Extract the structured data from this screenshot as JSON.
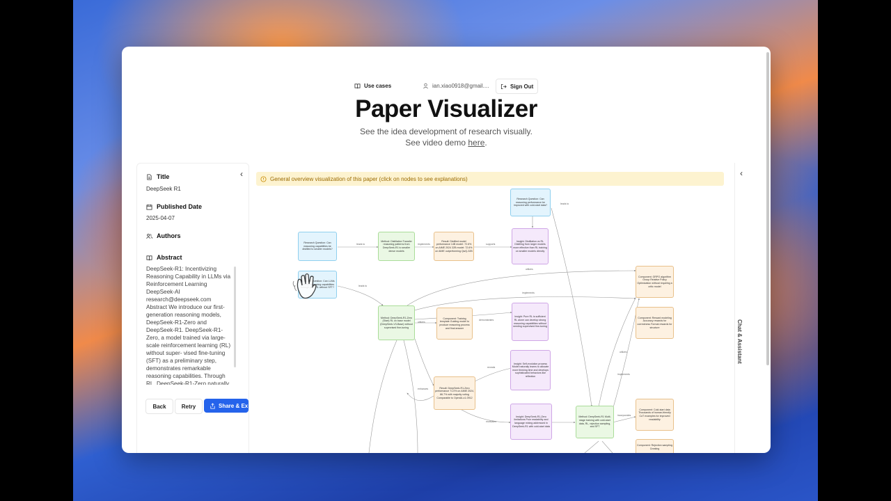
{
  "nav": {
    "use_cases": "Use cases",
    "email": "ian.xiao0918@gmail....",
    "sign_out": "Sign Out"
  },
  "header": {
    "title": "Paper Visualizer",
    "subtitle": "See the idea development of research visually.",
    "demo_prefix": "See video demo ",
    "demo_link": "here",
    "demo_suffix": "."
  },
  "paper": {
    "title_label": "Title",
    "title_value": "DeepSeek R1",
    "date_label": "Published Date",
    "date_value": "2025-04-07",
    "authors_label": "Authors",
    "abstract_label": "Abstract",
    "abstract_text": "DeepSeek-R1: Incentivizing Reasoning Capability in LLMs via Reinforcement Learning DeepSeek-AI research@deepseek.com Abstract We introduce our first-generation reasoning models, DeepSeek-R1-Zero and DeepSeek-R1. DeepSeek-R1-Zero, a model trained via large-scale reinforcement learning (RL) without super- vised fine-tuning (SFT) as a preliminary step, demonstrates remarkable reasoning capabilities. Through RL, DeepSeek-R1-Zero naturally"
  },
  "actions": {
    "back": "Back",
    "retry": "Retry",
    "share": "Share & Ex"
  },
  "banner": "General overview visualization of this paper (click on nodes to see explanations)",
  "sidebar_right": {
    "label": "Chat & Assistant"
  },
  "colors": {
    "accent": "#2563eb",
    "banner_bg": "#fdf3d0"
  },
  "graph": {
    "nodes": [
      {
        "id": "rq1",
        "color": "blue",
        "text": "Research Question: Can reasoning capabilities be distilled to smaller models?"
      },
      {
        "id": "m1",
        "color": "green",
        "text": "Method: Distillation Transfer reasoning patterns from DeepSeek-R1 to smaller dense models"
      },
      {
        "id": "r1",
        "color": "orange",
        "text": "Result: Distilled model performance 14B model: 72.6% on AIME 2024 32B model: 72.6% on AIME outperforming QwQ-32B"
      },
      {
        "id": "i1",
        "color": "purple",
        "text": "Insight: Distillation vs RL Distilling from larger models more effective than RL training on smaller models directly"
      },
      {
        "id": "rq0",
        "color": "blue",
        "text": "Research Question: Can reasoning performance be improved with cold-start data?"
      },
      {
        "id": "rq2",
        "color": "blue",
        "text": "Research Question: Can LLMs develop reasoning capabilities through pure RL without SFT?"
      },
      {
        "id": "m2",
        "color": "green",
        "text": "Method: DeepSeek-R1-Zero (Start) RL on base model (DeepSeek-V3-Base) without supervised fine-tuning"
      },
      {
        "id": "c1",
        "color": "orange",
        "text": "Component: Training template Guiding model to produce reasoning process and final answer"
      },
      {
        "id": "i2",
        "color": "purple",
        "text": "Insight: Pure RL is sufficient RL alone can develop strong reasoning capabilities without needing supervised fine-tuning"
      },
      {
        "id": "c2",
        "color": "orange",
        "text": "Component: GRPO algorithm Group Relative Policy Optimization without requiring a critic model"
      },
      {
        "id": "c3",
        "color": "orange",
        "text": "Component: Reward modeling Accuracy rewards for correctness Format rewards for structure"
      },
      {
        "id": "i3",
        "color": "purple",
        "text": "Insight: Self-evolution process Model naturally learns to allocate more thinking time and develops sophisticated behaviors like reflection"
      },
      {
        "id": "r2",
        "color": "orange",
        "text": "Result: DeepSeek-R1-Zero performance 71.0% on AIME 2024, 86.7% with majority voting Comparable to OpenAI-o1-0912"
      },
      {
        "id": "i4",
        "color": "purple",
        "text": "Insight: DeepSeek-R1-Zero limitations Poor readability and language mixing addressed in DeepSeek-R1 with cold-start data"
      },
      {
        "id": "m3",
        "color": "green",
        "text": "Method: DeepSeek-R1 Multi-stage training with cold-start data, RL, rejection sampling, and SFT"
      },
      {
        "id": "c4",
        "color": "orange",
        "text": "Component: Cold-start data Thousands of human-friendly CoT examples for improved readability"
      },
      {
        "id": "c5",
        "color": "orange",
        "text": "Component: Rejection sampling Creating"
      }
    ],
    "edge_labels": [
      "leads to",
      "leads to",
      "implements",
      "supports",
      "leads to",
      "utilizes",
      "utilizes",
      "implements",
      "demonstrates",
      "reveals",
      "enhances",
      "motivates",
      "incorporates",
      "utilizes",
      "implements"
    ]
  }
}
